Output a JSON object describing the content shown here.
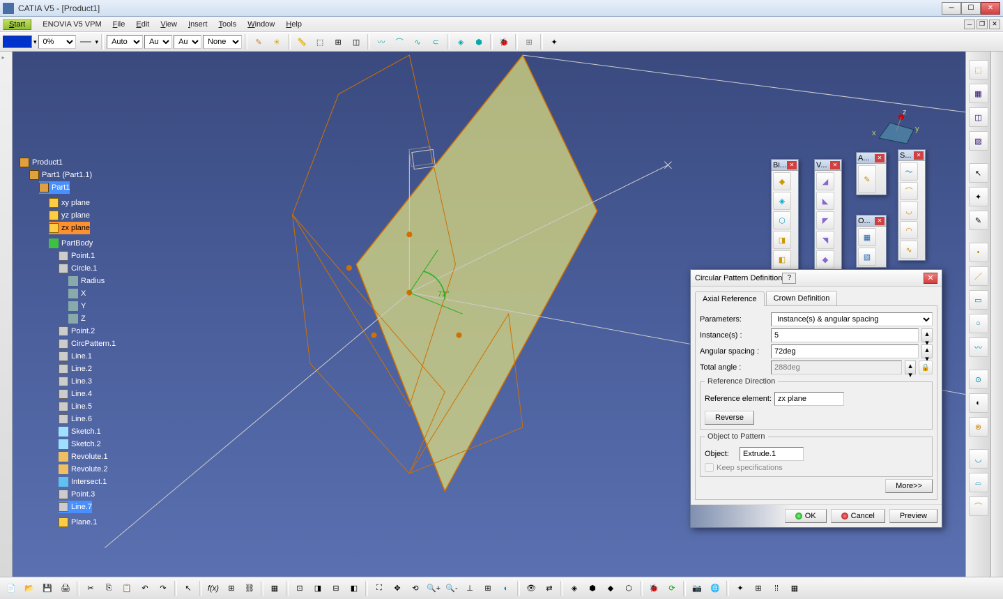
{
  "titlebar": {
    "title": "CATIA V5 - [Product1]"
  },
  "menu": {
    "start": "Start",
    "items": [
      "ENOVIA V5 VPM",
      "File",
      "Edit",
      "View",
      "Insert",
      "Tools",
      "Window",
      "Help"
    ]
  },
  "toolbar": {
    "opacity": "0%",
    "auto1": "Auto",
    "auto2": "Aut",
    "auto3": "Aut",
    "none": "None"
  },
  "tree": {
    "root": "Product1",
    "part1": "Part1 (Part1.1)",
    "part": "Part1",
    "planes": [
      "xy plane",
      "yz plane",
      "zx plane"
    ],
    "body": "PartBody",
    "nodes": [
      "Point.1",
      "Circle.1",
      "Radius",
      "X",
      "Y",
      "Z",
      "Point.2",
      "CircPattern.1",
      "Line.1",
      "Line.2",
      "Line.3",
      "Line.4",
      "Line.5",
      "Line.6",
      "Sketch.1",
      "Sketch.2",
      "Revolute.1",
      "Revolute.2",
      "Intersect.1",
      "Point.3",
      "Line.7",
      "Plane.1"
    ]
  },
  "angle_label": "72°",
  "compass": {
    "x": "x",
    "y": "y",
    "z": "z"
  },
  "float_toolbars": {
    "tb1": "Bi...",
    "tb2": "V...",
    "tb3": "A...",
    "tb4": "S...",
    "tb5": "O..."
  },
  "dialog": {
    "title": "Circular Pattern Definition",
    "tab1": "Axial Reference",
    "tab2": "Crown Definition",
    "param_label": "Parameters:",
    "param_value": "Instance(s) & angular spacing",
    "instances_label": "Instance(s) :",
    "instances_value": "5",
    "spacing_label": "Angular spacing :",
    "spacing_value": "72deg",
    "total_label": "Total angle :",
    "total_value": "288deg",
    "refdir_legend": "Reference Direction",
    "refelem_label": "Reference element:",
    "refelem_value": "zx plane",
    "reverse": "Reverse",
    "obj_legend": "Object to Pattern",
    "object_label": "Object:",
    "object_value": "Extrude.1",
    "keepspec": "Keep specifications",
    "more": "More>>",
    "ok": "OK",
    "cancel": "Cancel",
    "preview": "Preview"
  }
}
